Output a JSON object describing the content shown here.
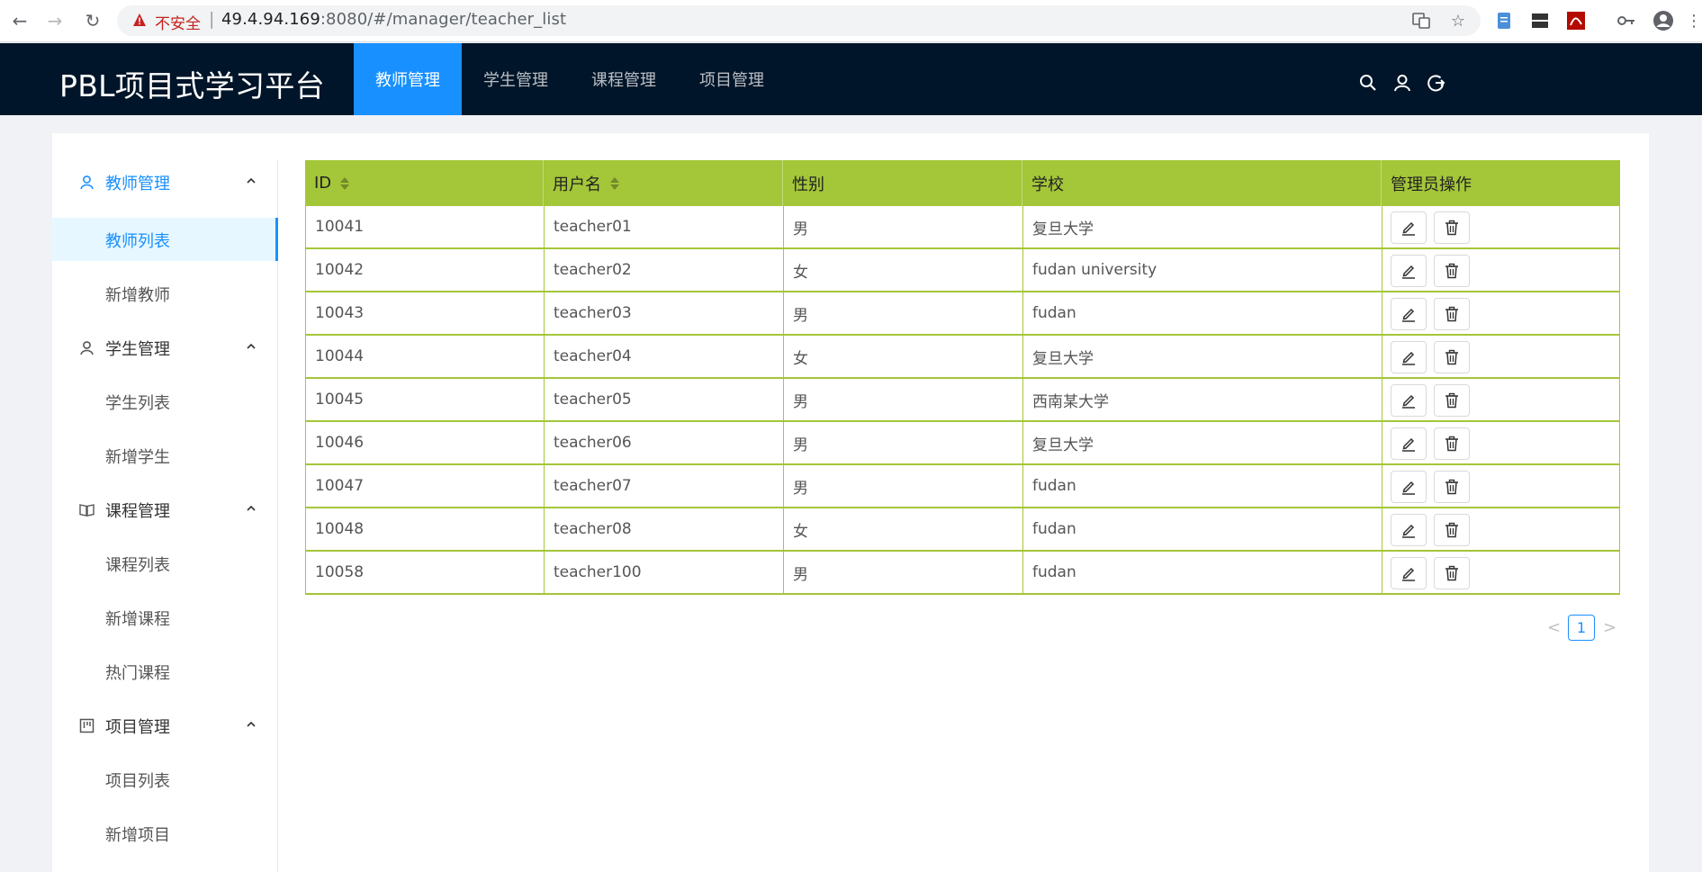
{
  "browser": {
    "insecure_label": "不安全",
    "separator": "|",
    "url_host": "49.4.94.169",
    "url_rest": ":8080/#/manager/teacher_list"
  },
  "header": {
    "brand": "PBL项目式学习平台",
    "tabs": [
      {
        "label": "教师管理",
        "active": true
      },
      {
        "label": "学生管理",
        "active": false
      },
      {
        "label": "课程管理",
        "active": false
      },
      {
        "label": "项目管理",
        "active": false
      }
    ]
  },
  "sidebar": {
    "groups": [
      {
        "title": "教师管理",
        "icon": "user-icon",
        "open": true,
        "items": [
          "教师列表",
          "新增教师"
        ]
      },
      {
        "title": "学生管理",
        "icon": "user-icon",
        "open": false,
        "items": [
          "学生列表",
          "新增学生"
        ]
      },
      {
        "title": "课程管理",
        "icon": "book-icon",
        "open": false,
        "items": [
          "课程列表",
          "新增课程",
          "热门课程"
        ]
      },
      {
        "title": "项目管理",
        "icon": "project-icon",
        "open": false,
        "items": [
          "项目列表",
          "新增项目"
        ]
      }
    ],
    "selected_item": "教师列表"
  },
  "table": {
    "columns": [
      "ID",
      "用户名",
      "性别",
      "学校",
      "管理员操作"
    ],
    "rows": [
      [
        "10041",
        "teacher01",
        "男",
        "复旦大学"
      ],
      [
        "10042",
        "teacher02",
        "女",
        "fudan university"
      ],
      [
        "10043",
        "teacher03",
        "男",
        "fudan"
      ],
      [
        "10044",
        "teacher04",
        "女",
        "复旦大学"
      ],
      [
        "10045",
        "teacher05",
        "男",
        "西南某大学"
      ],
      [
        "10046",
        "teacher06",
        "男",
        "复旦大学"
      ],
      [
        "10047",
        "teacher07",
        "男",
        "fudan"
      ],
      [
        "10048",
        "teacher08",
        "女",
        "fudan"
      ],
      [
        "10058",
        "teacher100",
        "男",
        "fudan"
      ]
    ]
  },
  "pagination": {
    "prev": "<",
    "current": "1",
    "next": ">"
  },
  "colors": {
    "header_bg": "#001529",
    "accent": "#1890ff",
    "table_header": "#a4c639"
  }
}
